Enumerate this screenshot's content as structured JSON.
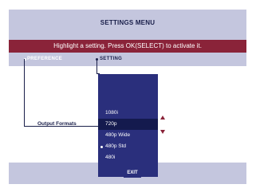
{
  "menu": {
    "title": "SETTINGS MENU",
    "instruction": "Highlight a setting. Press OK(SELECT) to activate it."
  },
  "headers": {
    "preference": "PREFERENCE",
    "setting": "SETTING"
  },
  "field": {
    "label": "Output Formats"
  },
  "options": [
    {
      "label": "1080i",
      "selected": false,
      "active": false
    },
    {
      "label": "720p",
      "selected": true,
      "active": false
    },
    {
      "label": "480p Wide",
      "selected": false,
      "active": false
    },
    {
      "label": "480p Std",
      "selected": false,
      "active": true
    },
    {
      "label": "480i",
      "selected": false,
      "active": false
    }
  ],
  "footer": {
    "exit_label": "EXIT"
  },
  "colors": {
    "frame_bg": "#c4c6de",
    "banner": "#8a2339",
    "list_bg": "#2a2f7c",
    "selected_bg": "#141a4e",
    "text_dark": "#1a1f4a"
  },
  "icons": [
    "scroll-up-arrow-icon",
    "scroll-down-arrow-icon"
  ]
}
